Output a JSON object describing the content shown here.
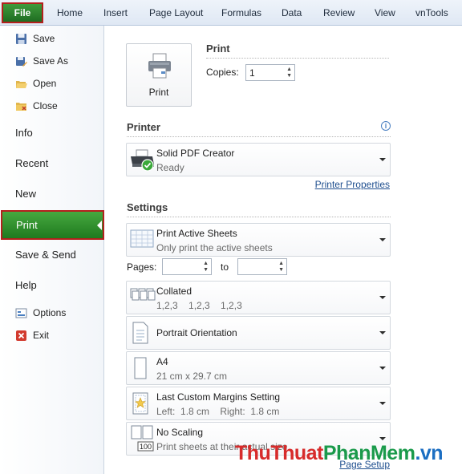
{
  "ribbon": {
    "file_tab": "File",
    "tabs": [
      "Home",
      "Insert",
      "Page Layout",
      "Formulas",
      "Data",
      "Review",
      "View",
      "vnTools"
    ]
  },
  "sidebar": {
    "save": "Save",
    "save_as": "Save As",
    "open": "Open",
    "close": "Close",
    "info": "Info",
    "recent": "Recent",
    "new": "New",
    "print": "Print",
    "save_send": "Save & Send",
    "help": "Help",
    "options": "Options",
    "exit": "Exit"
  },
  "print_section": {
    "heading": "Print",
    "button_label": "Print",
    "copies_label": "Copies:",
    "copies_value": "1"
  },
  "printer": {
    "heading": "Printer",
    "name": "Solid PDF Creator",
    "status": "Ready",
    "properties_link": "Printer Properties"
  },
  "settings": {
    "heading": "Settings",
    "print_what": {
      "title": "Print Active Sheets",
      "subtitle": "Only print the active sheets"
    },
    "pages_label": "Pages:",
    "to_label": "to",
    "pages_from": "",
    "pages_to": "",
    "collation": {
      "title": "Collated",
      "subtitle": "1,2,3    1,2,3    1,2,3"
    },
    "orientation": {
      "title": "Portrait Orientation"
    },
    "paper": {
      "title": "A4",
      "subtitle": "21 cm x 29.7 cm"
    },
    "margins": {
      "title": "Last Custom Margins Setting",
      "subtitle": "Left:  1.8 cm    Right:  1.8 cm"
    },
    "scaling": {
      "title": "No Scaling",
      "subtitle": "Print sheets at their actual size"
    },
    "page_setup_link": "Page Setup"
  },
  "watermark": {
    "part1": "ThuThuat",
    "part2": "PhanMem",
    "part3": ".vn"
  },
  "colors": {
    "file_tab": "#2a7d2a",
    "selected": "#2f8f2f",
    "highlight_border": "#b3201d",
    "link": "#1f4f8f"
  }
}
